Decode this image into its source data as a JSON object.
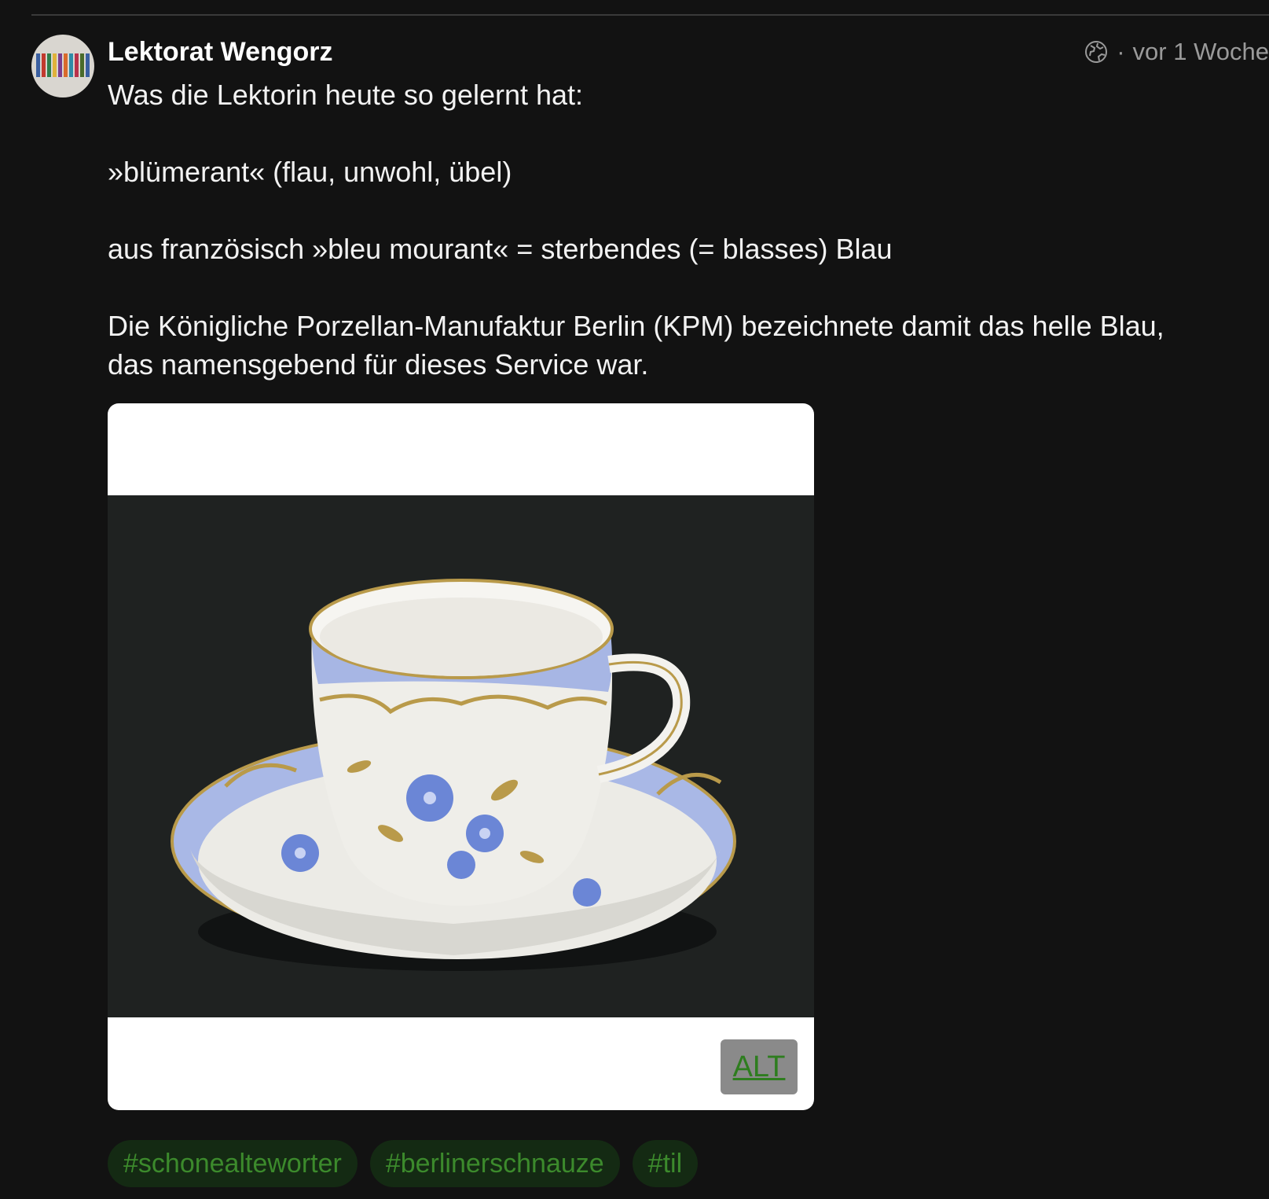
{
  "post": {
    "author": "Lektorat Wengorz",
    "timestamp": "vor 1 Woche",
    "visibility_icon": "globe-icon",
    "lines": [
      "Was die Lektorin heute so gelernt hat:",
      "»blümerant« (flau, unwohl, übel)",
      "aus französisch »bleu mourant« = sterbendes (= blasses) Blau",
      "Die Königliche Porzellan-Manufaktur Berlin (KPM) bezeichnete damit das helle Blau,",
      "das namensgebend für dieses Service war."
    ],
    "media": {
      "alt_label": "ALT"
    },
    "tags": [
      "#schonealteworter",
      "#berlinerschnauze",
      "#til"
    ]
  },
  "colors": {
    "background": "#121212",
    "tag_text": "#3c8a2c",
    "tag_bg": "#142a13",
    "alt_badge_bg": "#8a8a8a"
  }
}
